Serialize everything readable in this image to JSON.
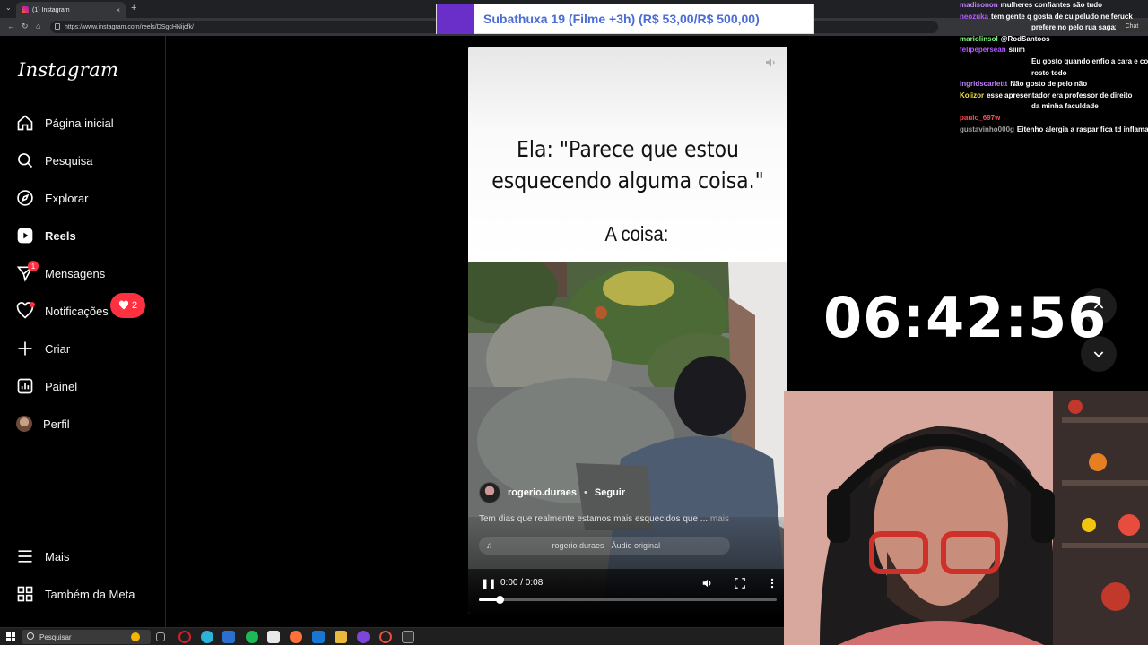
{
  "browser": {
    "tab_title": "(1) Instagram",
    "url": "https://www.instagram.com/reels/DSgcHNijcfk/"
  },
  "sidebar": {
    "logo": "Instagram",
    "items": [
      {
        "label": "Página inicial",
        "icon": "home-icon"
      },
      {
        "label": "Pesquisa",
        "icon": "search-icon"
      },
      {
        "label": "Explorar",
        "icon": "compass-icon"
      },
      {
        "label": "Reels",
        "icon": "reels-icon",
        "active": true
      },
      {
        "label": "Mensagens",
        "icon": "messenger-icon",
        "badge": "1"
      },
      {
        "label": "Notificações",
        "icon": "heart-icon",
        "pill_count": "2"
      },
      {
        "label": "Criar",
        "icon": "plus-icon"
      },
      {
        "label": "Painel",
        "icon": "dashboard-icon"
      },
      {
        "label": "Perfil",
        "icon": "avatar"
      }
    ],
    "bottom_items": [
      {
        "label": "Mais",
        "icon": "menu-icon"
      },
      {
        "label": "Também da Meta",
        "icon": "meta-grid-icon"
      }
    ]
  },
  "reel": {
    "caption_line1": "Ela: \"Parece que estou esquecendo alguma coisa.\"",
    "caption_line2": "A coisa:",
    "author": "rogerio.duraes",
    "separator": "•",
    "follow_label": "Seguir",
    "description": "Tem dias que realmente estamos mais esquecidos que ...",
    "more_label": " mais",
    "audio": "rogerio.duraes · Áudio original",
    "time": "0:00 / 0:08",
    "progress": 0.07
  },
  "stream": {
    "sub_goal": "Subathuxa 19 (Filme +3h) (R$ 53,00/R$ 500,00)",
    "timer": "06:42:56",
    "chat_tab": "Chat",
    "chat": [
      {
        "user": "madisonon",
        "color": "#c080ff",
        "msg": "mulheres confiantes são tudo"
      },
      {
        "user": "neozuka",
        "color": "#b45cff",
        "msg": "tem gente q gosta de cu peludo ne feruck"
      },
      {
        "user": "",
        "color": "#ffffff",
        "msg": "prefere no pelo rua sagaz"
      },
      {
        "user": "mariolinsol",
        "color": "#7cfc7c",
        "msg": "@RodSantoos"
      },
      {
        "user": "felipepersean",
        "color": "#b45cff",
        "msg": "siiim"
      },
      {
        "user": "",
        "color": "#ffffff",
        "msg": "Eu gosto quando enfio a cara e cobre meu"
      },
      {
        "user": "",
        "color": "#ffffff",
        "msg": "rosto todo"
      },
      {
        "user": "ingridscarlettt",
        "color": "#c080ff",
        "msg": "Não gosto de pelo não"
      },
      {
        "user": "Kolizor",
        "color": "#f5e04a",
        "msg": "esse apresentador era professor de direito"
      },
      {
        "user": "",
        "color": "#ffffff",
        "msg": "da minha faculdade"
      },
      {
        "user": "paulo_697w",
        "color": "#ff4d4d",
        "msg": ""
      },
      {
        "user": "gustavinho000g",
        "color": "#a0a0a0",
        "msg": "Eitenho alergia a raspar fica td inflamado"
      }
    ]
  },
  "taskbar": {
    "search_placeholder": "Pesquisar"
  },
  "colors": {
    "background": "#000000",
    "badge_red": "#ff3040",
    "sub_purple": "#6b2fc9",
    "sub_text": "#4a6cd4"
  }
}
